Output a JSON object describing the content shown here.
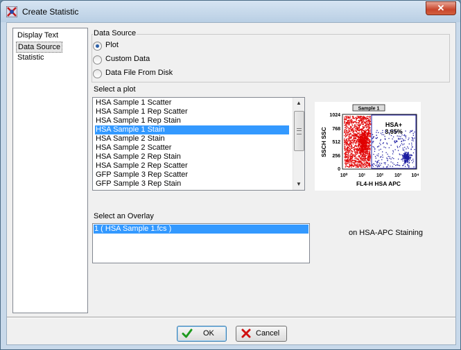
{
  "window": {
    "title": "Create Statistic",
    "close_glyph": "✕"
  },
  "nav": {
    "items": [
      "Display Text",
      "Data Source",
      "Statistic"
    ],
    "selected_index": 1
  },
  "data_source": {
    "group_title": "Data Source",
    "options": [
      "Plot",
      "Custom Data",
      "Data File From Disk"
    ],
    "selected_index": 0
  },
  "plot_list": {
    "label": "Select a plot",
    "items": [
      "HSA Sample 1 Scatter",
      "HSA Sample 1 Rep Scatter",
      "HSA Sample 1 Rep Stain",
      "HSA Sample 1 Stain",
      "HSA Sample 2 Stain",
      "HSA Sample 2 Scatter",
      "HSA Sample 2 Rep Stain",
      "HSA Sample 2 Rep Scatter",
      "GFP Sample 3 Rep Scatter",
      "GFP Sample 3 Rep Stain"
    ],
    "selected_index": 3
  },
  "preview": {
    "sample_label": "Sample 1",
    "y_axis_label": "SSCH SSC",
    "x_axis_label": "FL4-H HSA APC",
    "y_ticks": [
      "1024",
      "768",
      "512",
      "256",
      "0"
    ],
    "x_ticks": [
      "10⁰",
      "10¹",
      "10²",
      "10³",
      "10⁴"
    ],
    "gate_name": "HSA+",
    "gate_percent": "3.65%",
    "colors": {
      "negative": "#e00000",
      "positive": "#1a1aa0",
      "gate": "#1a1aa0"
    }
  },
  "overlay_list": {
    "label": "Select an Overlay",
    "items": [
      "1 ( HSA Sample 1.fcs )"
    ],
    "selected_index": 0
  },
  "caption": "on HSA-APC Staining",
  "buttons": {
    "ok": "OK",
    "cancel": "Cancel"
  },
  "colors": {
    "selection": "#3399ff",
    "ok_check": "#1e9a1e",
    "cancel_x": "#d01010"
  }
}
